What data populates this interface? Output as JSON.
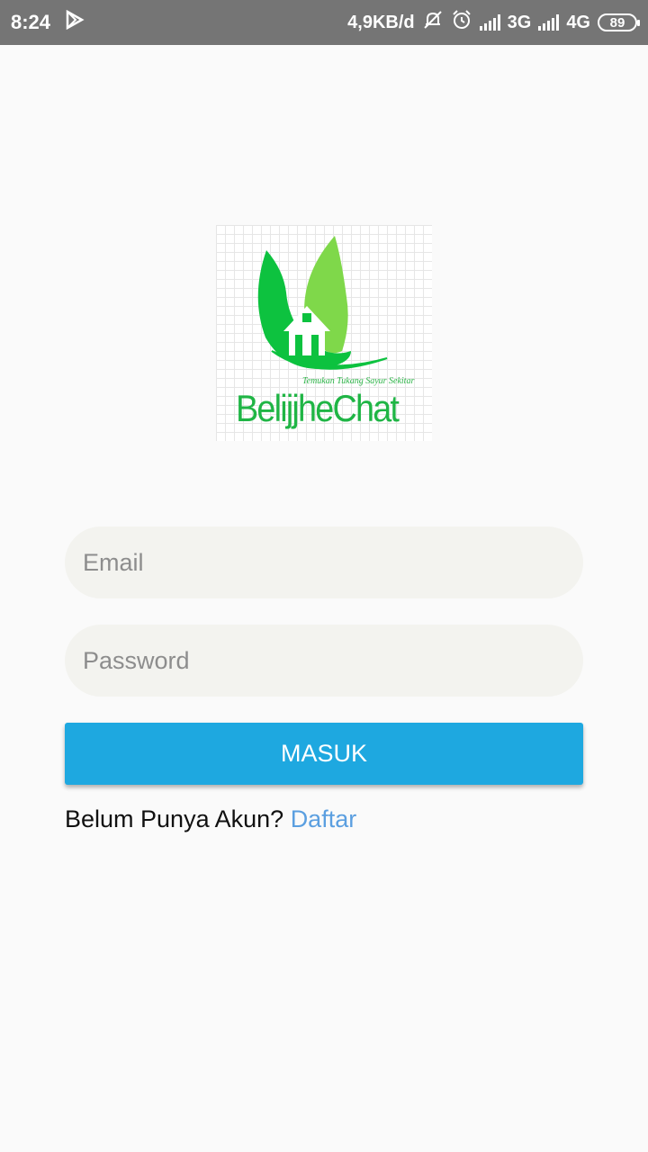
{
  "status_bar": {
    "time": "8:24",
    "net_speed": "4,9KB/d",
    "network_1": "3G",
    "network_2": "4G",
    "battery": "89"
  },
  "logo": {
    "tagline": "Temukan Tukang Sayur Sekitar",
    "title": "BelijjheChat",
    "colors": {
      "leaf_dark": "#0dc23f",
      "leaf_light": "#7fd84a",
      "text": "#1fb545"
    }
  },
  "login_form": {
    "email_placeholder": "Email",
    "password_placeholder": "Password",
    "submit_label": "MASUK",
    "register_prompt": "Belum Punya Akun?",
    "register_link": "Daftar"
  },
  "colors": {
    "accent": "#1ea8e0",
    "link": "#5b9fe0",
    "status_bar_bg": "#757575"
  }
}
